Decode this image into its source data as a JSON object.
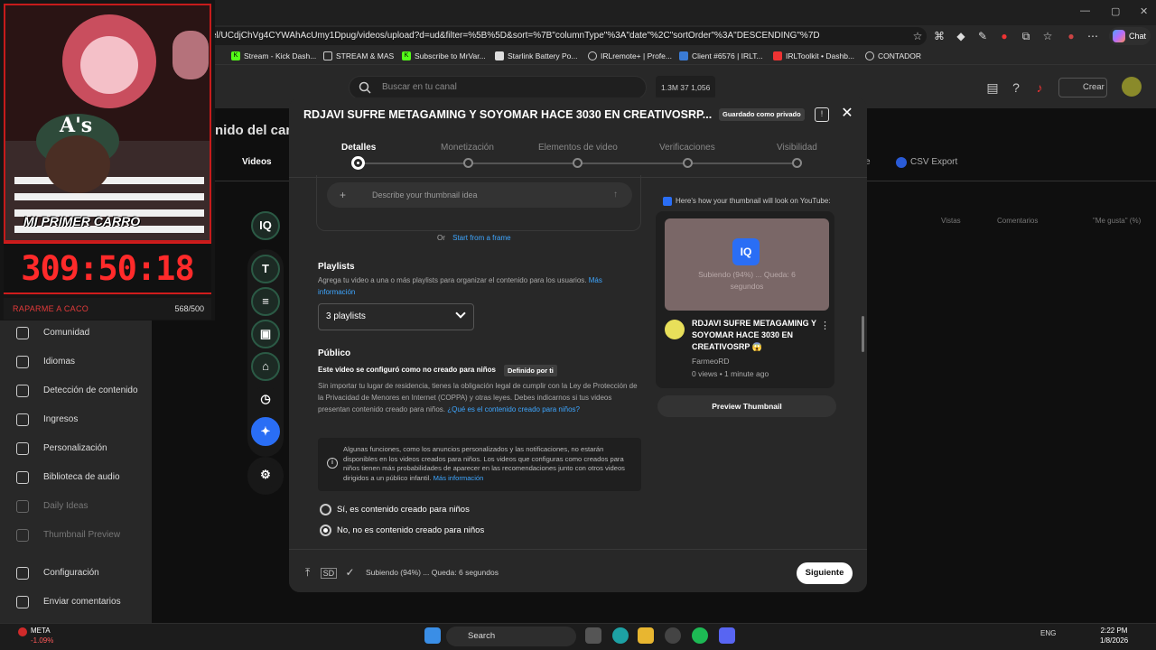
{
  "browser": {
    "url": "el/UCdjChVg4CYWAhAcUmy1Dpug/videos/upload?d=ud&filter=%5B%5D&sort=%7B\"columnType\"%3A\"date\"%2C\"sortOrder\"%3A\"DESCENDING\"%7D",
    "chat_label": "Chat",
    "bookmarks": [
      "Stream - Kick Dash...",
      "STREAM & MAS",
      "Subscribe to MrVar...",
      "Starlink Battery Po...",
      "IRLremote+ | Profe...",
      "Client #6576 | IRLT...",
      "IRLToolkit • Dashb...",
      "CONTADOR"
    ]
  },
  "header": {
    "search_placeholder": "Buscar en tu canal",
    "stats": "1.3M   37   1,056",
    "create_label": "Crear"
  },
  "sidebar": {
    "items": [
      {
        "label": "Comunidad",
        "dim": false
      },
      {
        "label": "Idiomas",
        "dim": false
      },
      {
        "label": "Detección de contenido",
        "dim": false
      },
      {
        "label": "Ingresos",
        "dim": false
      },
      {
        "label": "Personalización",
        "dim": false
      },
      {
        "label": "Biblioteca de audio",
        "dim": false
      },
      {
        "label": "Daily Ideas",
        "dim": true
      },
      {
        "label": "Thumbnail Preview",
        "dim": true
      },
      {
        "label": "Configuración",
        "dim": false
      },
      {
        "label": "Enviar comentarios",
        "dim": false
      }
    ]
  },
  "background": {
    "title": "nido del cana",
    "tab_partial": "n",
    "tab_videos": "Videos",
    "tab_e": "e",
    "csv_label": "CSV Export",
    "col_views": "Vistas",
    "col_comments": "Comentarios",
    "col_likes": "\"Me gusta\" (%)"
  },
  "overlay": {
    "timer": "309:50:18",
    "goal_label": "RAPARME A CACO",
    "goal_count": "568/500",
    "banner": "MI PRIMER CARRO"
  },
  "dialog": {
    "title": "RDJAVI SUFRE METAGAMING Y SOYOMAR HACE 3030 EN CREATIVOSRP...",
    "saved_badge": "Guardado como privado",
    "steps": [
      "Detalles",
      "Monetización",
      "Elementos de video",
      "Verificaciones",
      "Visibilidad"
    ],
    "thumb_idea_placeholder": "Describe your thumbnail idea",
    "or_text": "Or",
    "start_frame": "Start from a frame",
    "playlists": {
      "heading": "Playlists",
      "desc": "Agrega tu video a una o más playlists para organizar el contenido para los usuarios.",
      "more": "Más información",
      "selected": "3 playlists"
    },
    "publico": {
      "heading": "Público",
      "sub": "Este video se configuró como no creado para niños",
      "badge": "Definido por ti",
      "desc": "Sin importar tu lugar de residencia, tienes la obligación legal de cumplir con la Ley de Protección de la Privacidad de Menores en Internet (COPPA) y otras leyes. Debes indicarnos si tus videos presentan contenido creado para niños.",
      "link": "¿Qué es el contenido creado para niños?",
      "info": "Algunas funciones, como los anuncios personalizados y las notificaciones, no estarán disponibles en los videos creados para niños. Los videos que configuras como creados para niños tienen más probabilidades de aparecer en las recomendaciones junto con otros videos dirigidos a un público infantil.",
      "info_link": "Más información",
      "option_yes": "Sí, es contenido creado para niños",
      "option_no": "No, no es contenido creado para niños",
      "selected": "no"
    },
    "preview": {
      "heading": "Here's how your thumbnail will look on YouTube:",
      "iq": "IQ",
      "uploading": "Subiendo (94%) ... Queda: 6 segundos",
      "video_title": "RDJAVI SUFRE METAGAMING Y SOYOMAR HACE 3030 EN CREATIVOSRP 😱",
      "channel": "FarmeoRD",
      "meta": "0 views • 1 minute ago",
      "button": "Preview Thumbnail"
    },
    "footer": {
      "status": "Subiendo (94%) ... Queda: 6 segundos",
      "next": "Siguiente"
    }
  },
  "rail": {
    "iq": "IQ"
  },
  "taskbar": {
    "stock_name": "META",
    "stock_change": "-1.09%",
    "search": "Search",
    "lang": "ENG",
    "time": "2:22 PM",
    "date": "1/8/2026"
  }
}
